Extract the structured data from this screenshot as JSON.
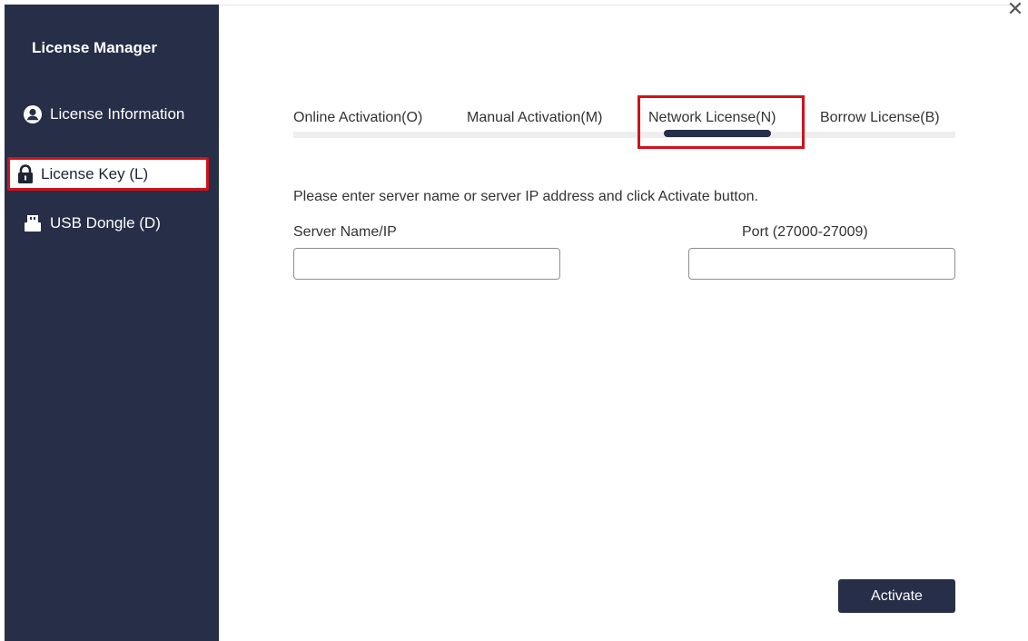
{
  "window": {
    "title": "License Manager",
    "close_icon": "close-icon"
  },
  "sidebar": {
    "items": [
      {
        "label": "License Information",
        "icon": "user-circle-icon"
      },
      {
        "label": "License Key (L)",
        "icon": "lock-icon"
      },
      {
        "label": "USB Dongle (D)",
        "icon": "usb-drive-icon"
      }
    ]
  },
  "tabs": [
    {
      "label": "Online Activation(O)"
    },
    {
      "label": "Manual Activation(M)"
    },
    {
      "label": "Network License(N)"
    },
    {
      "label": "Borrow License(B)"
    }
  ],
  "main": {
    "instruction": "Please enter server name or server IP address and click Activate button.",
    "server_label": "Server Name/IP",
    "server_value": "",
    "port_label": "Port (27000-27009)",
    "port_value": "",
    "activate_label": "Activate"
  },
  "colors": {
    "sidebar_bg": "#272e48",
    "highlight": "#d0121b",
    "accent": "#272e48"
  }
}
